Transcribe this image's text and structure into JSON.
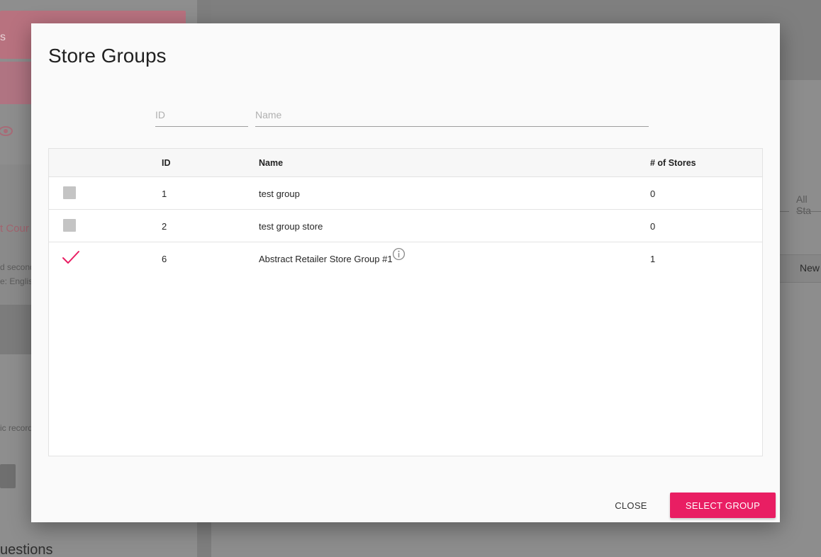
{
  "background": {
    "sidebar_pink_letter": "s",
    "sidebar_pink_text": "t Cour",
    "sidebar_line1": "d second",
    "sidebar_line2": "e: Englis",
    "sidebar_line3": "ic record",
    "questions_heading": "uestions",
    "filter_placeholder": "All Sta",
    "new_label": "New"
  },
  "dialog": {
    "title": "Store Groups",
    "filters": {
      "id_placeholder": "ID",
      "name_placeholder": "Name"
    },
    "table": {
      "headers": {
        "id": "ID",
        "name": "Name",
        "stores": "# of Stores"
      },
      "rows": [
        {
          "id": "1",
          "name": "test group",
          "stores": "0",
          "selected": false
        },
        {
          "id": "2",
          "name": "test group store",
          "stores": "0",
          "selected": false
        },
        {
          "id": "6",
          "name": "Abstract Retailer Store Group #1",
          "stores": "1",
          "selected": true,
          "info_icon": "info-icon"
        }
      ]
    },
    "actions": {
      "close_label": "CLOSE",
      "select_label": "SELECT GROUP"
    }
  },
  "colors": {
    "accent": "#e91e63",
    "checkbox_unchecked": "#c4c4c4"
  }
}
